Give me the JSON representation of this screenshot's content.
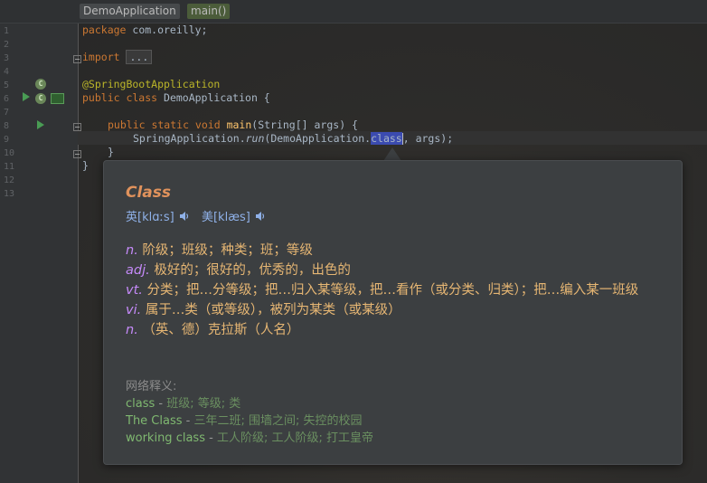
{
  "breadcrumbs": [
    {
      "label": "DemoApplication"
    },
    {
      "label": "main()"
    }
  ],
  "line_numbers": [
    "1",
    "2",
    "3",
    "4",
    "5",
    "6",
    "7",
    "8",
    "9",
    "10",
    "11",
    "12",
    "13"
  ],
  "code": {
    "l1_kw": "package",
    "l1_rest": " com.oreilly;",
    "l3_kw": "import",
    "l3_fold": "...",
    "l5_ann": "@SpringBootApplication",
    "l6_kw": "public class",
    "l6_rest": " DemoApplication {",
    "l9_kw": "public static void",
    "l9_fn": "main",
    "l9_rest": "(String[] args) {",
    "l10_pre": "SpringApplication.",
    "l10_call": "run",
    "l10_mid": "(DemoApplication.",
    "l10_hl": "class",
    "l10_end": ", args);",
    "l11": "}",
    "l12": "}"
  },
  "popup": {
    "word": "Class",
    "phonetic_uk": "英[klɑːs]",
    "phonetic_us": "美[klæs]",
    "definitions": [
      {
        "pos": "n.",
        "text": " 阶级；班级；种类；班；等级"
      },
      {
        "pos": "adj.",
        "text": " 极好的；很好的，优秀的，出色的"
      },
      {
        "pos": "vt.",
        "text": " 分类；把…分等级；把…归入某等级，把…看作（或分类、归类）；把…编入某一班级"
      },
      {
        "pos": "vi.",
        "text": " 属于…类（或等级），被列为某类（或某级）"
      },
      {
        "pos": "n.",
        "text": " （英、德）克拉斯（人名）"
      }
    ],
    "web_title": "网络释义:",
    "web_items": [
      {
        "term": "class",
        "sep": " - ",
        "meaning": "班级; 等级; 类"
      },
      {
        "term": "The Class",
        "sep": " - ",
        "meaning": "三年二班; 围墙之间; 失控的校园"
      },
      {
        "term": "working class",
        "sep": " - ",
        "meaning": "工人阶级; 工人阶级; 打工皇帝"
      }
    ]
  },
  "icons": {
    "run": "run-icon",
    "spring_bean": "spring-bean-icon",
    "speaker": "speaker-icon"
  },
  "colors": {
    "background": "#2b2b2b",
    "keyword": "#cc7832",
    "annotation": "#bbb529",
    "word": "#e0925c",
    "definition": "#e6b673",
    "part_of_speech": "#c58af9",
    "web_term": "#7fb870"
  }
}
